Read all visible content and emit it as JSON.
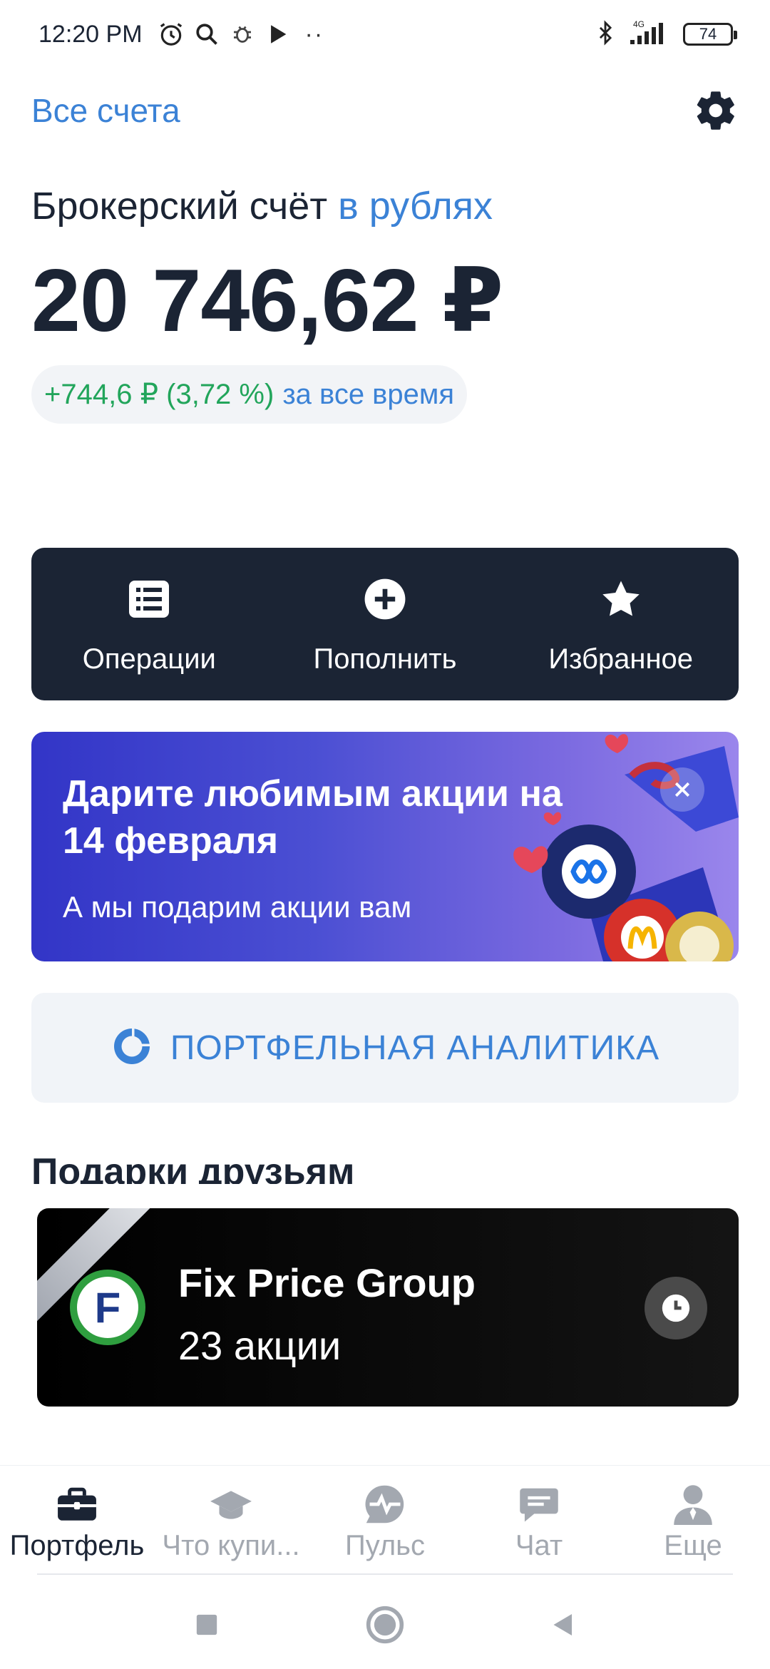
{
  "status_bar": {
    "time": "12:20 PM",
    "network": "4G",
    "battery": "74"
  },
  "header": {
    "all_accounts": "Все счета"
  },
  "account": {
    "title": "Брокерский счёт",
    "currency_link": "в рублях",
    "balance": "20 746,62 ₽",
    "change": "+744,6 ₽ (3,72 %)",
    "change_period": "за все время",
    "colors": {
      "gain": "#22a55b",
      "link": "#3b82d6"
    }
  },
  "actions": [
    {
      "label": "Операции",
      "icon": "list-icon"
    },
    {
      "label": "Пополнить",
      "icon": "plus-circle-icon"
    },
    {
      "label": "Избранное",
      "icon": "star-icon"
    }
  ],
  "promo": {
    "title": "Дарите любимым акции на 14 февраля",
    "subtitle": "А мы подарим акции вам"
  },
  "analytics": {
    "label": "ПОРТФЕЛЬНАЯ АНАЛИТИКА"
  },
  "gifts": {
    "section_title": "Подарки друзьям",
    "card": {
      "company": "Fix Price Group",
      "shares": "23 акции",
      "logo_letter": "F"
    }
  },
  "bottom_nav": [
    {
      "label": "Портфель",
      "icon": "briefcase-icon",
      "active": true
    },
    {
      "label": "Что купи...",
      "icon": "graduation-cap-icon",
      "active": false
    },
    {
      "label": "Пульс",
      "icon": "pulse-icon",
      "active": false
    },
    {
      "label": "Чат",
      "icon": "chat-icon",
      "active": false
    },
    {
      "label": "Еще",
      "icon": "profile-icon",
      "active": false
    }
  ]
}
